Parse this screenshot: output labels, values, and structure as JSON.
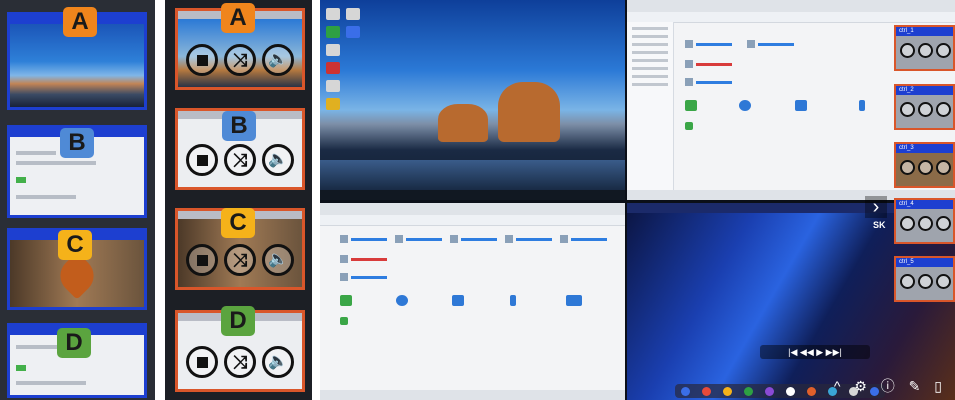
{
  "panel1": {
    "labels": [
      "A",
      "B",
      "C",
      "D"
    ]
  },
  "panel2": {
    "labels": [
      "A",
      "B",
      "C",
      "D"
    ],
    "controls": [
      "stop-button",
      "crossfade-button",
      "volume-button"
    ]
  },
  "panel3": {
    "floating_thumbs": [
      "ctrl_1",
      "ctrl_2",
      "ctrl_3",
      "ctrl_4",
      "ctrl_5"
    ],
    "scroll_indicator": "›",
    "overlay": "^ ⚙ ⓘ ✎ ▯",
    "media_text": "|◀  ◀◀  ▶  ▶▶|",
    "side_text": "SK"
  },
  "colors": {
    "frame_blue": "#1d3fd0",
    "frame_orange": "#d9562a",
    "label_a": "#f0851c",
    "label_b": "#4f8ad6",
    "label_c": "#f5b21a",
    "label_d": "#5ba43f"
  }
}
